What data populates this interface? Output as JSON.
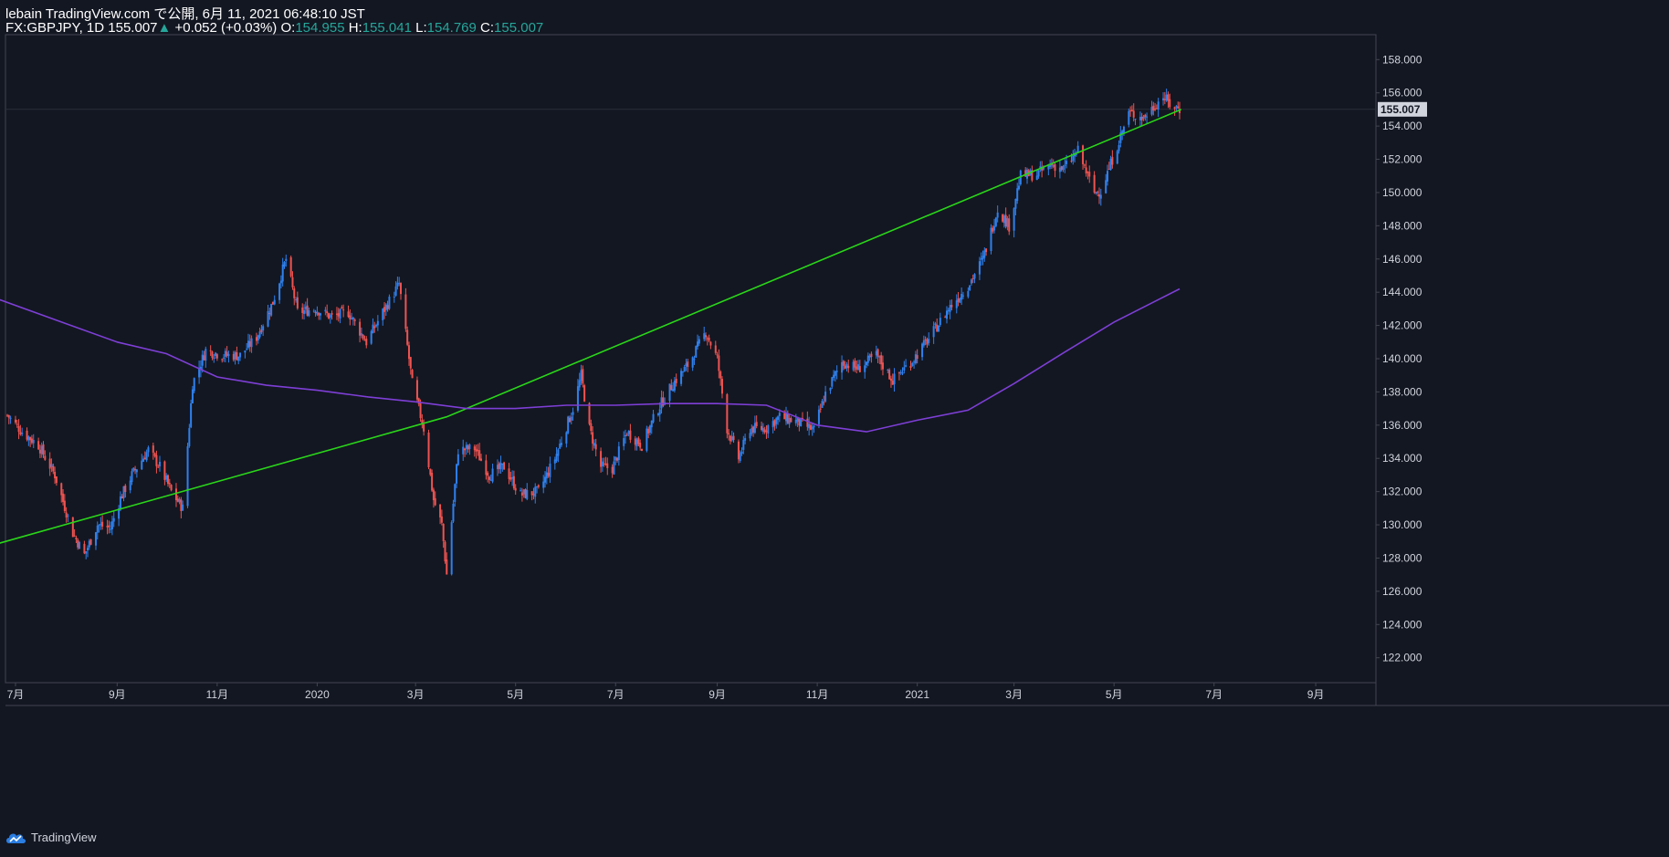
{
  "header": {
    "publish_line": "lebain TradingView.com で公開, 6月 11, 2021 06:48:10 JST",
    "symbol": "FX:GBPJPY, 1D",
    "last": "155.007",
    "up_arrow": "▲",
    "change": "+0.052 (+0.03%)",
    "open_label": "O:",
    "open": "154.955",
    "high_label": "H:",
    "high": "155.041",
    "low_label": "L:",
    "low": "154.769",
    "close_label": "C:",
    "close": "155.007"
  },
  "footer": {
    "brand": "TradingView",
    "icon": "tradingview-cloud-icon"
  },
  "colors": {
    "background": "#131722",
    "up": "#2f80ed",
    "down": "#ef5350",
    "trendline": "#2ad51a",
    "moving_average": "#7e3fd6",
    "axis_text": "#d1d4dc",
    "price_label_bg": "#d1d4dc"
  },
  "chart_data": {
    "type": "candlestick",
    "title": "",
    "xlabel": "",
    "ylabel": "",
    "ylim": [
      120.5,
      159.5
    ],
    "y_ticks": [
      "122.000",
      "124.000",
      "126.000",
      "128.000",
      "130.000",
      "132.000",
      "134.000",
      "136.000",
      "138.000",
      "140.000",
      "142.000",
      "144.000",
      "146.000",
      "148.000",
      "150.000",
      "152.000",
      "154.000",
      "156.000",
      "158.000"
    ],
    "x_ticks": [
      "7月",
      "9月",
      "11月",
      "2020",
      "3月",
      "5月",
      "7月",
      "9月",
      "11月",
      "2021",
      "3月",
      "5月",
      "7月",
      "9月"
    ],
    "last_price_label": "155.007",
    "series": [
      {
        "kind": "close_path",
        "x": [
          "2019-06-26",
          "2019-07-05",
          "2019-07-15",
          "2019-07-25",
          "2019-08-05",
          "2019-08-12",
          "2019-08-20",
          "2019-08-28",
          "2019-09-03",
          "2019-09-10",
          "2019-09-20",
          "2019-09-27",
          "2019-10-04",
          "2019-10-11",
          "2019-10-17",
          "2019-10-25",
          "2019-11-05",
          "2019-11-15",
          "2019-11-25",
          "2019-12-05",
          "2019-12-13",
          "2019-12-20",
          "2019-12-31",
          "2020-01-10",
          "2020-01-20",
          "2020-01-31",
          "2020-02-10",
          "2020-02-20",
          "2020-02-28",
          "2020-03-06",
          "2020-03-12",
          "2020-03-17",
          "2020-03-20",
          "2020-03-27",
          "2020-04-06",
          "2020-04-15",
          "2020-04-24",
          "2020-05-04",
          "2020-05-15",
          "2020-05-25",
          "2020-06-05",
          "2020-06-10",
          "2020-06-15",
          "2020-06-22",
          "2020-06-29",
          "2020-07-08",
          "2020-07-17",
          "2020-07-27",
          "2020-08-05",
          "2020-08-14",
          "2020-08-25",
          "2020-09-01",
          "2020-09-07",
          "2020-09-14",
          "2020-09-21",
          "2020-09-30",
          "2020-10-09",
          "2020-10-20",
          "2020-10-30",
          "2020-11-06",
          "2020-11-16",
          "2020-11-26",
          "2020-12-07",
          "2020-12-17",
          "2020-12-29",
          "2021-01-08",
          "2021-01-20",
          "2021-02-01",
          "2021-02-10",
          "2021-02-19",
          "2021-02-26",
          "2021-03-05",
          "2021-03-15",
          "2021-03-24",
          "2021-03-31",
          "2021-04-09",
          "2021-04-19",
          "2021-04-23",
          "2021-04-30",
          "2021-05-10",
          "2021-05-19",
          "2021-05-31",
          "2021-06-04",
          "2021-06-10"
        ],
        "values": [
          136.6,
          135.6,
          134.8,
          133.0,
          129.5,
          128.2,
          130.0,
          129.8,
          131.6,
          133.0,
          134.5,
          133.5,
          132.0,
          131.0,
          138.5,
          140.5,
          140.2,
          140.2,
          141.3,
          143.4,
          146.0,
          142.8,
          143.0,
          142.5,
          142.8,
          141.0,
          142.8,
          144.5,
          138.5,
          135.8,
          131.5,
          130.0,
          127.0,
          134.5,
          134.6,
          133.0,
          133.5,
          131.8,
          132.0,
          134.0,
          137.0,
          139.0,
          135.8,
          133.5,
          133.4,
          135.6,
          134.8,
          137.0,
          138.5,
          139.6,
          141.6,
          140.0,
          135.8,
          134.0,
          135.8,
          135.8,
          136.5,
          136.2,
          135.7,
          137.9,
          139.8,
          139.4,
          140.2,
          138.7,
          139.9,
          141.2,
          143.0,
          144.4,
          146.0,
          149.0,
          148.0,
          151.0,
          151.1,
          151.7,
          151.4,
          152.5,
          150.0,
          150.1,
          152.0,
          154.8,
          154.5,
          155.8,
          155.3,
          155.0
        ]
      },
      {
        "kind": "line",
        "name": "",
        "x": [
          "2019-05-20",
          "2020-03-20",
          "2021-06-11"
        ],
        "y": [
          128.0,
          136.5,
          155.0
        ]
      },
      {
        "kind": "moving_average",
        "name": "",
        "x": [
          "2019-06-20",
          "2019-08-01",
          "2019-09-01",
          "2019-10-01",
          "2019-11-01",
          "2019-12-01",
          "2020-01-01",
          "2020-02-01",
          "2020-03-01",
          "2020-04-01",
          "2020-05-01",
          "2020-06-01",
          "2020-07-01",
          "2020-08-01",
          "2020-09-01",
          "2020-10-01",
          "2020-11-01",
          "2020-12-01",
          "2021-01-01",
          "2021-02-01",
          "2021-03-01",
          "2021-04-01",
          "2021-05-01",
          "2021-06-10"
        ],
        "y": [
          143.6,
          142.1,
          141.0,
          140.3,
          138.9,
          138.4,
          138.1,
          137.7,
          137.4,
          137.0,
          137.0,
          137.2,
          137.2,
          137.3,
          137.3,
          137.2,
          136.0,
          135.6,
          136.3,
          136.9,
          138.5,
          140.4,
          142.2,
          144.2
        ]
      }
    ]
  }
}
